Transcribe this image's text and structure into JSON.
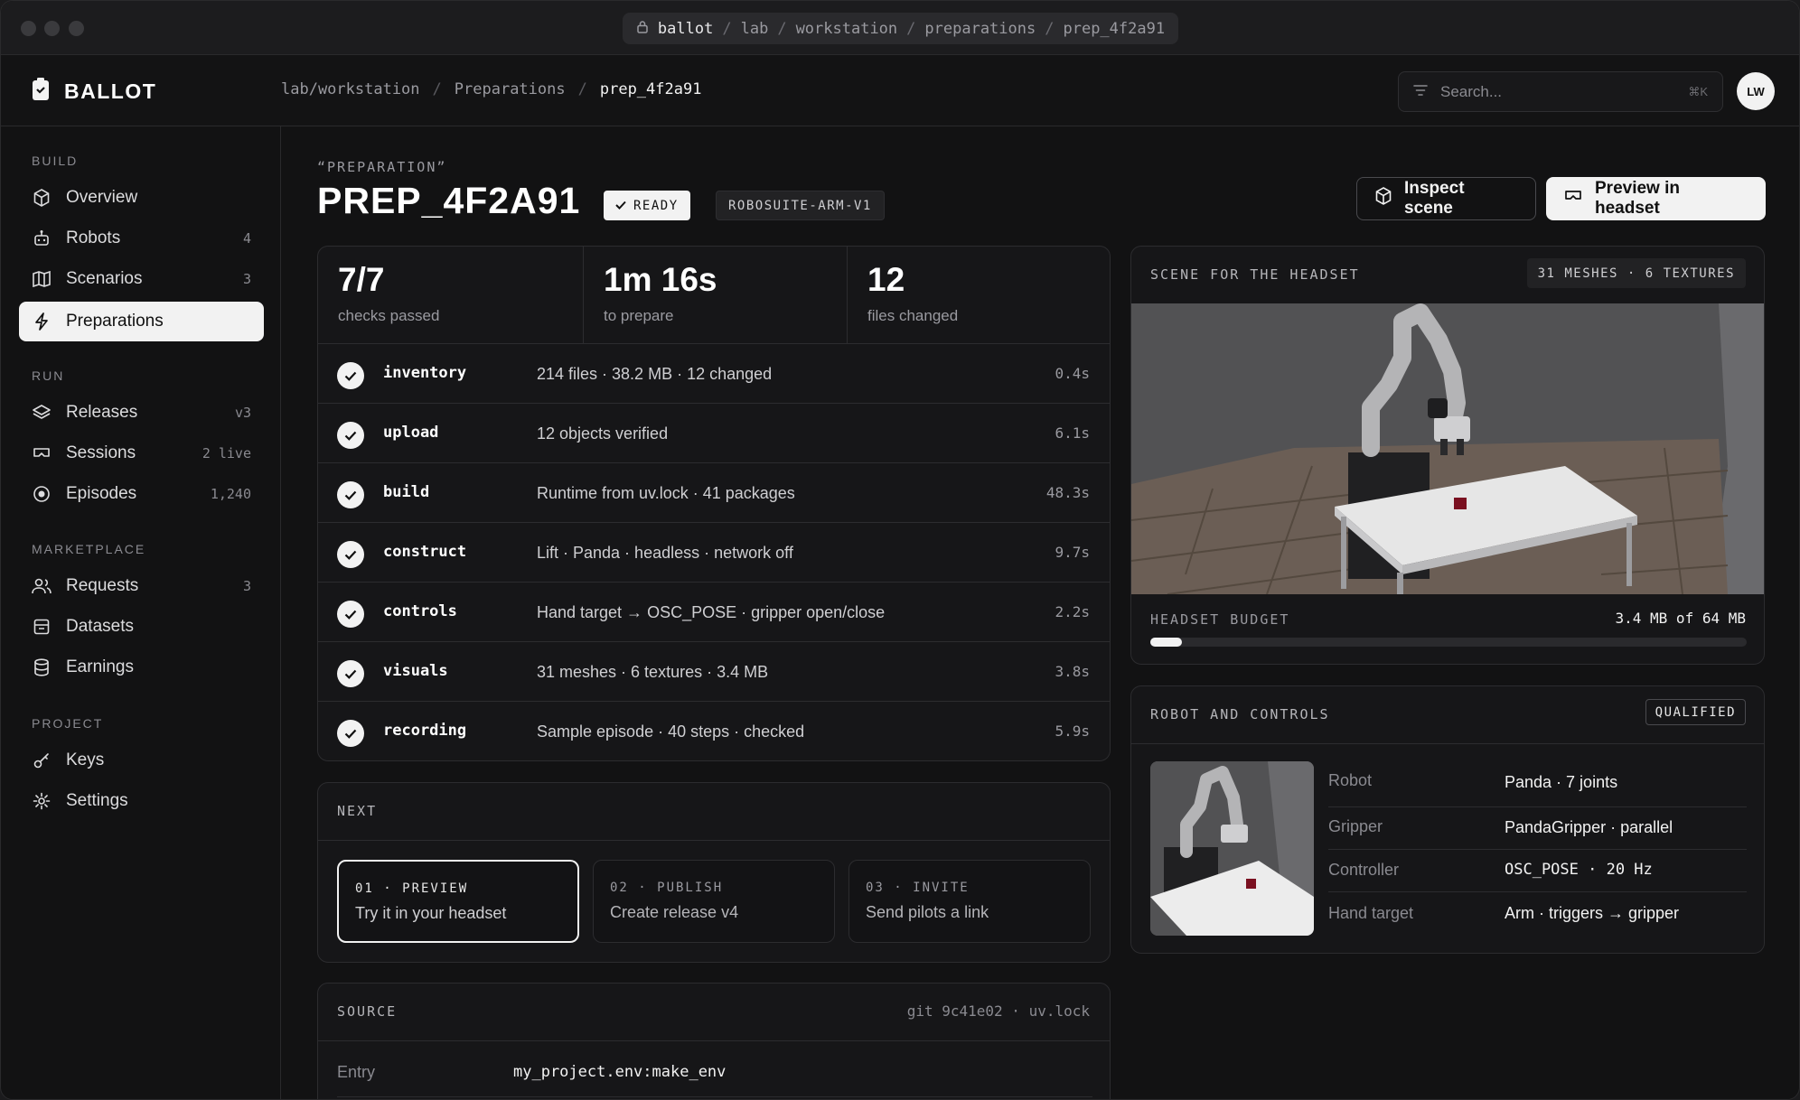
{
  "browser": {
    "url_segments": [
      "ballot",
      "/",
      "lab",
      "/",
      "workstation",
      "/",
      "preparations",
      "/",
      "prep_4f2a91"
    ]
  },
  "header": {
    "brand": "BALLOT",
    "breadcrumbs": [
      "lab/workstation",
      "/",
      "Preparations",
      "/",
      "prep_4f2a91"
    ],
    "search_placeholder": "Search...",
    "search_shortcut": "⌘K",
    "avatar_initials": "LW"
  },
  "sidebar": {
    "sections": [
      {
        "title": "BUILD",
        "items": [
          {
            "label": "Overview",
            "count": "",
            "icon": "cube-icon"
          },
          {
            "label": "Robots",
            "count": "4",
            "icon": "robot-icon"
          },
          {
            "label": "Scenarios",
            "count": "3",
            "icon": "map-icon"
          },
          {
            "label": "Preparations",
            "count": "",
            "icon": "bolt-icon",
            "active": true
          }
        ]
      },
      {
        "title": "RUN",
        "items": [
          {
            "label": "Releases",
            "count": "v3",
            "icon": "layers-icon"
          },
          {
            "label": "Sessions",
            "count": "2 live",
            "icon": "headset-icon"
          },
          {
            "label": "Episodes",
            "count": "1,240",
            "icon": "record-icon"
          }
        ]
      },
      {
        "title": "MARKETPLACE",
        "items": [
          {
            "label": "Requests",
            "count": "3",
            "icon": "users-icon"
          },
          {
            "label": "Datasets",
            "count": "",
            "icon": "archive-icon"
          },
          {
            "label": "Earnings",
            "count": "",
            "icon": "coins-icon"
          }
        ]
      },
      {
        "title": "PROJECT",
        "items": [
          {
            "label": "Keys",
            "count": "",
            "icon": "key-icon"
          },
          {
            "label": "Settings",
            "count": "",
            "icon": "gear-icon"
          }
        ]
      }
    ]
  },
  "page": {
    "eyebrow": "“PREPARATION”",
    "title": "PREP_4F2A91",
    "status": "READY",
    "env": "ROBOSUITE-ARM-V1",
    "inspect_label": "Inspect scene",
    "preview_label": "Preview in headset"
  },
  "stats": [
    {
      "value": "7/7",
      "label": "checks passed"
    },
    {
      "value": "1m 16s",
      "label": "to prepare"
    },
    {
      "value": "12",
      "label": "files changed"
    }
  ],
  "checks": [
    {
      "name": "inventory",
      "desc": "214 files · 38.2 MB · 12 changed",
      "time": "0.4s"
    },
    {
      "name": "upload",
      "desc": "12 objects verified",
      "time": "6.1s"
    },
    {
      "name": "build",
      "desc": "Runtime from uv.lock · 41 packages",
      "time": "48.3s"
    },
    {
      "name": "construct",
      "desc": "Lift · Panda · headless · network off",
      "time": "9.7s"
    },
    {
      "name": "controls",
      "desc": "Hand target → OSC_POSE · gripper open/close",
      "time": "2.2s"
    },
    {
      "name": "visuals",
      "desc": "31 meshes · 6 textures · 3.4 MB",
      "time": "3.8s"
    },
    {
      "name": "recording",
      "desc": "Sample episode · 40 steps · checked",
      "time": "5.9s"
    }
  ],
  "next": {
    "title": "NEXT",
    "steps": [
      {
        "key": "01 · PREVIEW",
        "value": "Try it in your headset"
      },
      {
        "key": "02 · PUBLISH",
        "value": "Create release v4"
      },
      {
        "key": "03 · INVITE",
        "value": "Send pilots a link"
      }
    ]
  },
  "source": {
    "title": "SOURCE",
    "meta": "git 9c41e02 · uv.lock",
    "entry_label": "Entry",
    "entry_value": "my_project.env:make_env"
  },
  "scene": {
    "title": "SCENE FOR THE HEADSET",
    "meta": "31 MESHES · 6 TEXTURES",
    "budget_label": "HEADSET BUDGET",
    "budget_value": "3.4 MB of 64 MB",
    "budget_fraction": 0.053
  },
  "robot": {
    "title": "ROBOT AND CONTROLS",
    "badge": "QUALIFIED",
    "rows": [
      {
        "label": "Robot",
        "value": "Panda · 7 joints"
      },
      {
        "label": "Gripper",
        "value": "PandaGripper · parallel"
      },
      {
        "label": "Controller",
        "value": "OSC_POSE · 20 Hz"
      },
      {
        "label": "Hand target",
        "value": "Arm · triggers → gripper"
      }
    ]
  },
  "colors": {
    "accent": "#f2f2f2",
    "background": "#121213",
    "card": "#161618"
  }
}
